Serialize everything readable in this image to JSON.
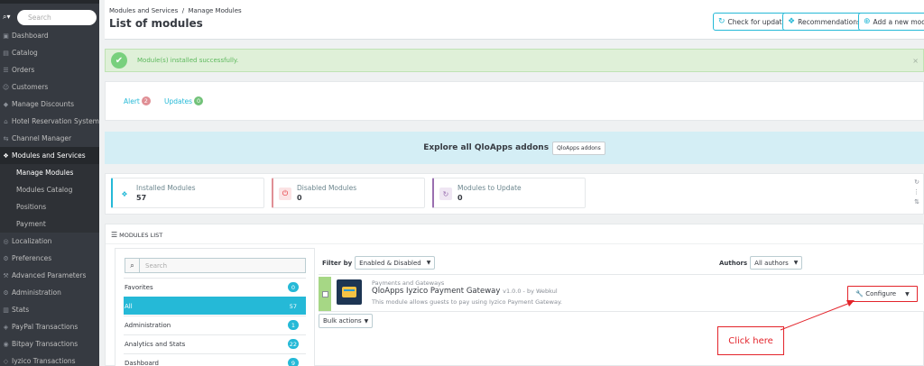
{
  "sidebar": {
    "search_placeholder": "Search",
    "items": [
      {
        "label": "Dashboard",
        "icon": "dashboard-icon"
      },
      {
        "label": "Catalog",
        "icon": "catalog-icon"
      },
      {
        "label": "Orders",
        "icon": "orders-icon"
      },
      {
        "label": "Customers",
        "icon": "customers-icon"
      },
      {
        "label": "Manage Discounts",
        "icon": "discounts-icon"
      },
      {
        "label": "Hotel Reservation System",
        "icon": "hotel-icon"
      },
      {
        "label": "Channel Manager",
        "icon": "channel-icon"
      },
      {
        "label": "Modules and Services",
        "icon": "modules-icon"
      }
    ],
    "subitems": [
      "Manage Modules",
      "Modules Catalog",
      "Positions",
      "Payment"
    ],
    "items_after": [
      {
        "label": "Localization",
        "icon": "localization-icon"
      },
      {
        "label": "Preferences",
        "icon": "preferences-icon"
      },
      {
        "label": "Advanced Parameters",
        "icon": "advanced-icon"
      },
      {
        "label": "Administration",
        "icon": "administration-icon"
      },
      {
        "label": "Stats",
        "icon": "stats-icon"
      },
      {
        "label": "PayPal Transactions",
        "icon": "paypal-icon"
      },
      {
        "label": "Bitpay Transactions",
        "icon": "bitpay-icon"
      },
      {
        "label": "Iyzico Transactions",
        "icon": "iyzico-icon"
      }
    ]
  },
  "header": {
    "breadcrumb_parent": "Modules and Services",
    "breadcrumb_sep": "/",
    "breadcrumb_current": "Manage Modules",
    "title": "List of modules",
    "buttons": {
      "check_update": "Check for update",
      "recommendations": "Recommendations",
      "add_module": "Add a new module"
    }
  },
  "alert": {
    "message": "Module(s) installed successfully.",
    "close": "×"
  },
  "tabs": {
    "alert_label": "Alert",
    "alert_count": "2",
    "updates_label": "Updates",
    "updates_count": "0"
  },
  "explore": {
    "text": "Explore all QloApps addons",
    "button": "QloApps addons"
  },
  "stats": [
    {
      "title": "Installed Modules",
      "value": "57"
    },
    {
      "title": "Disabled Modules",
      "value": "0"
    },
    {
      "title": "Modules to Update",
      "value": "0"
    }
  ],
  "modules_list": {
    "heading": "MODULES LIST",
    "search_placeholder": "Search",
    "categories": [
      {
        "name": "Favorites",
        "count": "0"
      },
      {
        "name": "All",
        "count": "57"
      },
      {
        "name": "Administration",
        "count": "1"
      },
      {
        "name": "Analytics and Stats",
        "count": "22"
      },
      {
        "name": "Dashboard",
        "count": "9"
      }
    ],
    "filter_label": "Filter by",
    "filter_value": "Enabled & Disabled",
    "authors_label": "Authors",
    "authors_value": "All authors",
    "module": {
      "category": "Payments and Gateways",
      "name": "QloApps Iyzico Payment Gateway",
      "version": "v1.0.0 - by Webkul",
      "description": "This module allows guests to pay using Iyzico Payment Gateway.",
      "configure": "Configure"
    },
    "bulk_actions": "Bulk actions"
  },
  "annotation": {
    "text": "Click here"
  }
}
